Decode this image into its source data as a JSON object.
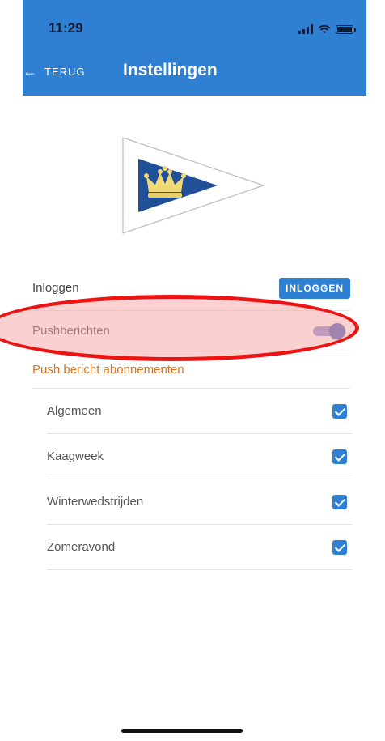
{
  "status": {
    "time": "11:29",
    "icons": [
      "signal-icon",
      "wifi-icon",
      "battery-icon"
    ]
  },
  "header": {
    "back_label": "TERUG",
    "title": "Instellingen",
    "background": "#2f7fd3"
  },
  "settings": {
    "login_label": "Inloggen",
    "login_button": "INLOGGEN",
    "push_label": "Pushberichten",
    "push_enabled": true,
    "subscriptions_title": "Push bericht abonnementen",
    "subscriptions": [
      {
        "label": "Algemeen",
        "checked": true
      },
      {
        "label": "Kaagweek",
        "checked": true
      },
      {
        "label": "Winterwedstrijden",
        "checked": true
      },
      {
        "label": "Zomeravond",
        "checked": true
      }
    ]
  },
  "colors": {
    "accent": "#2f7fd3",
    "section_title": "#d9741c",
    "highlight": "#ee1313"
  }
}
